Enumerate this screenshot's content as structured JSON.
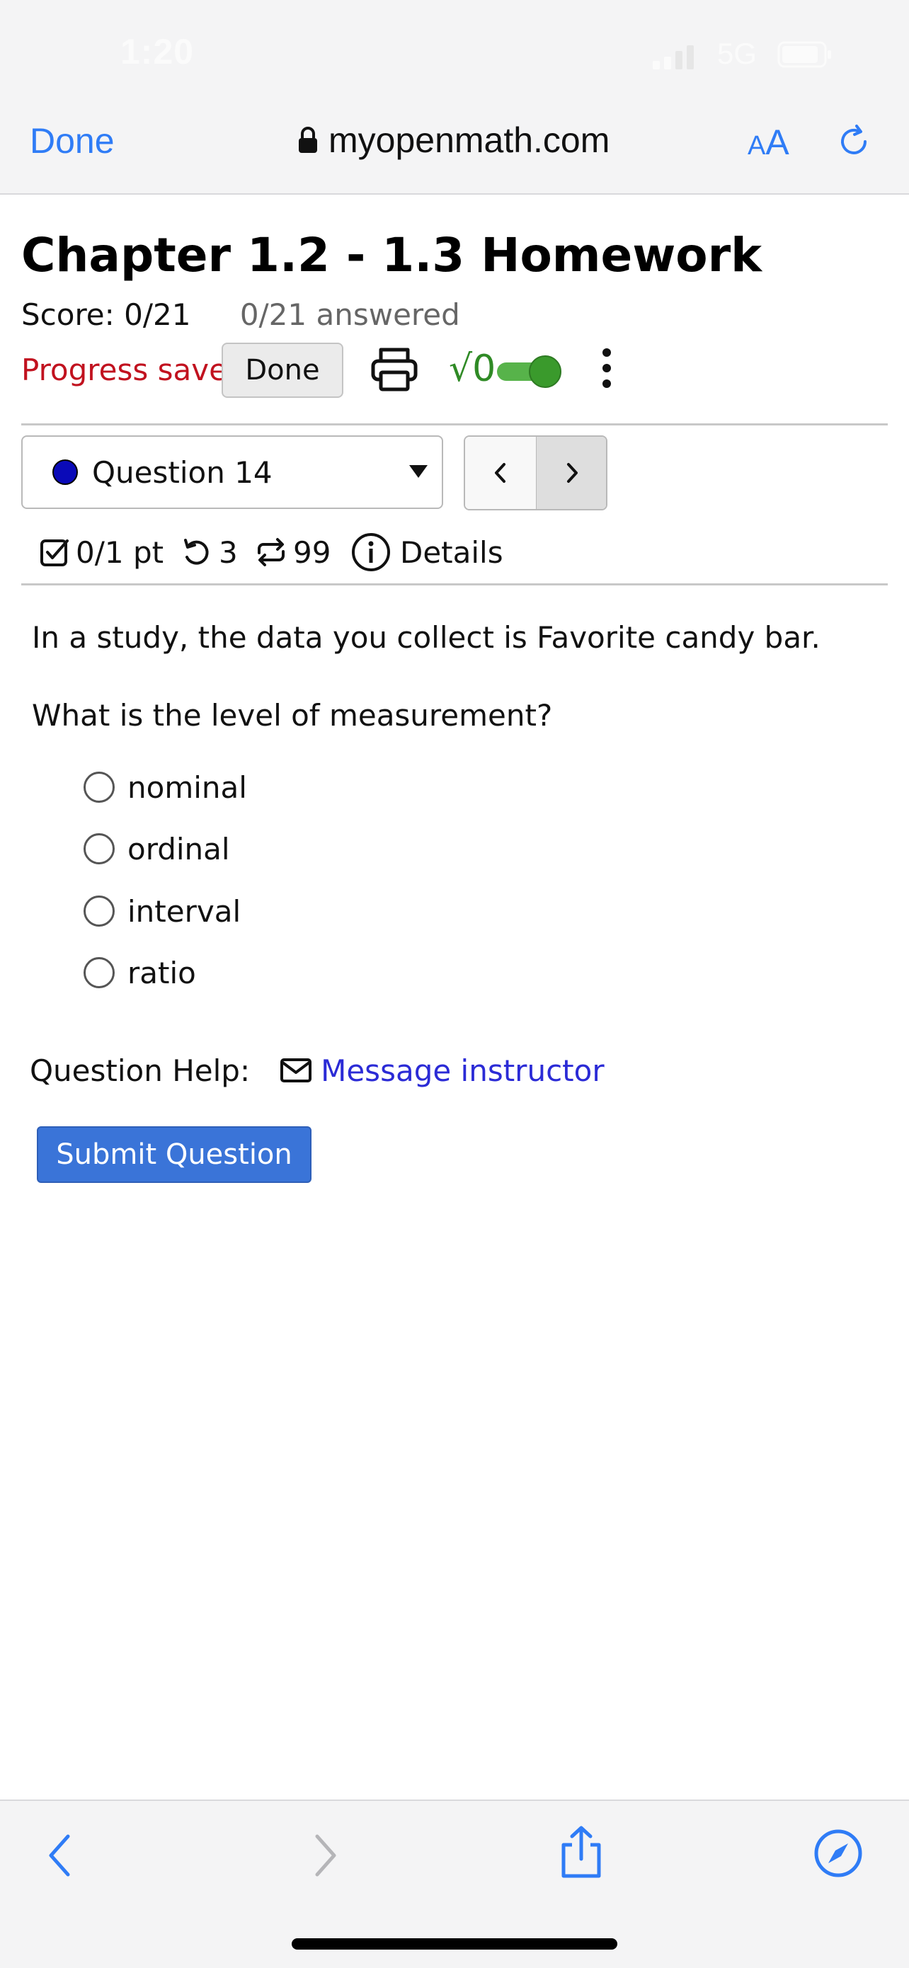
{
  "status_bar": {
    "time": "1:20",
    "network": "5G"
  },
  "safari": {
    "done_label": "Done",
    "url": "myopenmath.com",
    "aa_small": "A",
    "aa_big": "A"
  },
  "assignment": {
    "title": "Chapter 1.2 - 1.3 Homework",
    "score": "Score: 0/21",
    "answered": "0/21 answered",
    "progress_saved": "Progress saved",
    "done_label": "Done",
    "math_toggle_glyph": "√0",
    "math_toggle_on": true
  },
  "question_nav": {
    "selected": "Question 14",
    "prev_glyph": "<",
    "next_glyph": ">"
  },
  "question_meta": {
    "points": "0/1 pt",
    "retries": "3",
    "attempts": "99",
    "details": "Details"
  },
  "question": {
    "text": "In a study, the data you collect is Favorite candy bar.",
    "prompt": "What is the level of measurement?",
    "choices": [
      "nominal",
      "ordinal",
      "interval",
      "ratio"
    ]
  },
  "help": {
    "label": "Question Help:",
    "link": "Message instructor"
  },
  "submit_label": "Submit Question",
  "colors": {
    "safari_blue": "#2f7cf6",
    "progress_red": "#c1121f",
    "submit_blue": "#3a74d8",
    "toggle_green": "#3a9a2c",
    "link_blue": "#2b2bd6"
  },
  "icons": [
    "lock-icon",
    "reload-icon",
    "print-icon",
    "kebab-icon",
    "checkbox-icon",
    "retry-icon",
    "attempts-icon",
    "info-icon",
    "mail-icon",
    "back-icon",
    "forward-icon",
    "share-icon",
    "compass-icon"
  ]
}
